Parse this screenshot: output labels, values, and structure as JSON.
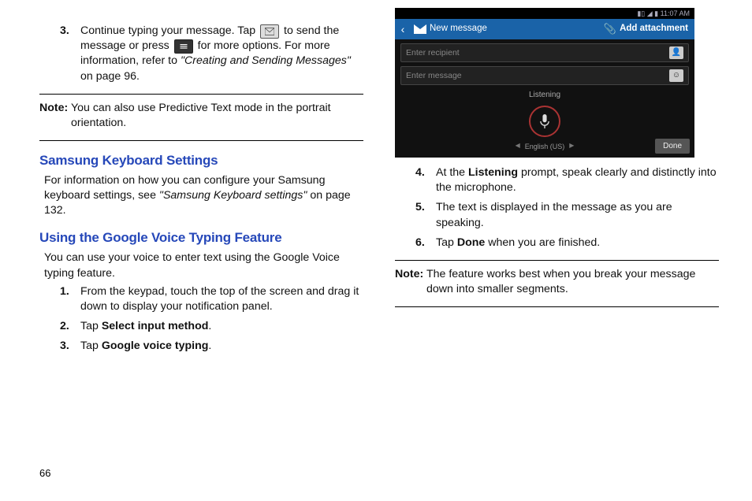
{
  "pageNumber": "66",
  "left": {
    "item3": {
      "num": "3.",
      "part1": "Continue typing your message. Tap ",
      "part2": " to send the message or press ",
      "part3": " for more options. For more information, refer to ",
      "ref": "\"Creating and Sending Messages\"",
      "part4": " on page 96."
    },
    "note1": {
      "label": "Note:",
      "text": " You can also use Predictive Text mode in the portrait orientation."
    },
    "h2a": "Samsung Keyboard Settings",
    "paraA1": "For information on how you can configure your Samsung keyboard settings, see ",
    "paraA1ref": "\"Samsung Keyboard settings\"",
    "paraA1end": " on page 132.",
    "h2b": "Using the Google Voice Typing Feature",
    "paraB1": "You can use your voice to enter text using the Google Voice typing feature.",
    "steps": {
      "s1": {
        "num": "1.",
        "text": "From the keypad, touch the top of the screen and drag it down to display your notification panel."
      },
      "s2": {
        "num": "2.",
        "pre": "Tap ",
        "bold": "Select input method",
        "post": "."
      },
      "s3": {
        "num": "3.",
        "pre": "Tap ",
        "bold": "Google voice typing",
        "post": "."
      }
    }
  },
  "right": {
    "phone": {
      "time": "11:07 AM",
      "title": "New message",
      "addAttachment": "Add attachment",
      "recipientPlaceholder": "Enter recipient",
      "messagePlaceholder": "Enter message",
      "listening": "Listening",
      "language": "English (US)",
      "done": "Done"
    },
    "steps": {
      "s4": {
        "num": "4.",
        "pre": "At the ",
        "bold": "Listening",
        "post": " prompt, speak clearly and distinctly into the microphone."
      },
      "s5": {
        "num": "5.",
        "text": "The text is displayed in the message as you are speaking."
      },
      "s6": {
        "num": "6.",
        "pre": "Tap ",
        "bold": "Done",
        "post": " when you are finished."
      }
    },
    "note2": {
      "label": "Note:",
      "text": " The feature works best when you break your message down into smaller segments."
    }
  }
}
